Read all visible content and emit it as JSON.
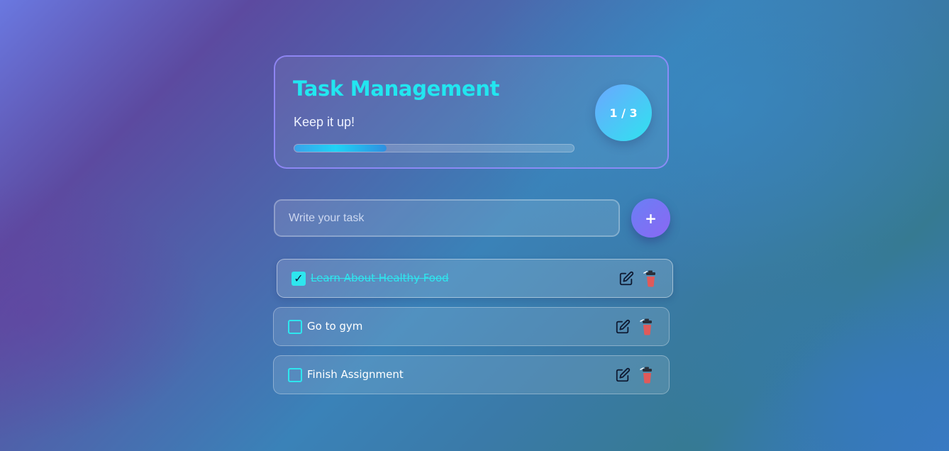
{
  "header": {
    "title": "Task Management",
    "subtitle": "Keep it up!",
    "counter": "1 / 3",
    "progress": 0.33
  },
  "input": {
    "placeholder": "Write your task",
    "value": ""
  },
  "add_button": {
    "label": "+"
  },
  "tasks": [
    {
      "text": "Learn About Healthy Food",
      "completed": true,
      "check_mark": "✓"
    },
    {
      "text": "Go to gym",
      "completed": false,
      "check_mark": ""
    },
    {
      "text": "Finish Assignment",
      "completed": false,
      "check_mark": ""
    }
  ],
  "icons": {
    "edit": "pencil-square-icon",
    "delete": "trash-can-icon"
  },
  "colors": {
    "accent": "#22e6f0",
    "card_border": "#968cff",
    "add_button": "#7a74f4",
    "trash": "#e05a5a"
  }
}
